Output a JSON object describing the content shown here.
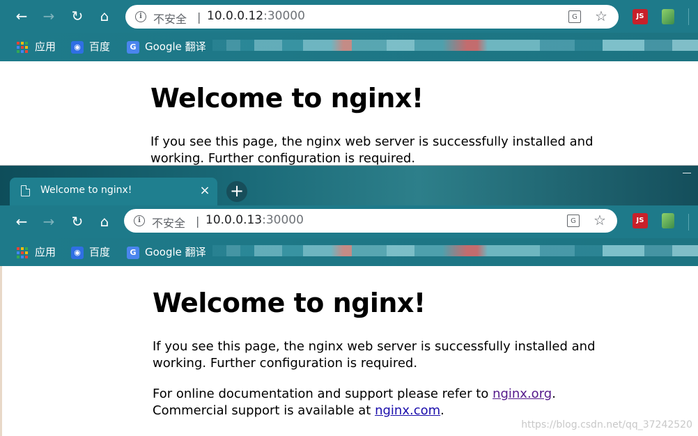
{
  "windows": [
    {
      "toolbar": {
        "back_icon": "back-arrow-icon",
        "forward_icon": "forward-arrow-icon",
        "reload_icon": "reload-icon",
        "home_icon": "home-icon"
      },
      "omnibox": {
        "security_label": "不安全",
        "divider": "|",
        "url_host": "10.0.0.12",
        "url_port": ":30000"
      },
      "extensions": {
        "js_label": "JS"
      },
      "bookmarks": [
        {
          "label": "应用"
        },
        {
          "label": "百度"
        },
        {
          "label": "Google 翻译"
        }
      ],
      "page": {
        "heading": "Welcome to nginx!",
        "para1": "If you see this page, the nginx web server is successfully installed and working. Further configuration is required."
      }
    },
    {
      "tab": {
        "title": "Welcome to nginx!",
        "close": "×",
        "new_tab": "+"
      },
      "toolbar": {
        "back_icon": "back-arrow-icon",
        "forward_icon": "forward-arrow-icon",
        "reload_icon": "reload-icon",
        "home_icon": "home-icon"
      },
      "omnibox": {
        "security_label": "不安全",
        "divider": "|",
        "url_host": "10.0.0.13",
        "url_port": ":30000"
      },
      "extensions": {
        "js_label": "JS"
      },
      "bookmarks": [
        {
          "label": "应用"
        },
        {
          "label": "百度"
        },
        {
          "label": "Google 翻译"
        }
      ],
      "page": {
        "heading": "Welcome to nginx!",
        "para1": "If you see this page, the nginx web server is successfully installed and working. Further configuration is required.",
        "para2_prefix": "For online documentation and support please refer to ",
        "link1": "nginx.org",
        "para2_mid": ".",
        "para2_line2_prefix": "Commercial support is available at ",
        "link2": "nginx.com",
        "para2_suffix": "."
      }
    }
  ],
  "watermark": "https://blog.csdn.net/qq_37242520",
  "colors": {
    "toolbar": "#1e7a8a",
    "tab_active": "#1f7f8f",
    "link": "#1a0dab",
    "link_visited": "#551a8b",
    "ext_js": "#c8202a"
  }
}
